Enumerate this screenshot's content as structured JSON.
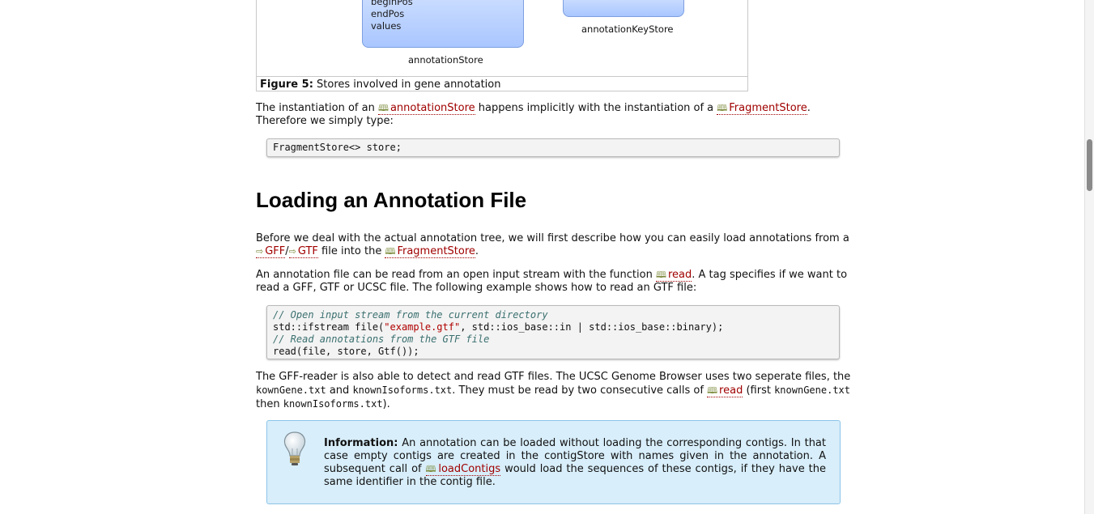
{
  "figure": {
    "store_a_fields": [
      "beginPos",
      "endPos",
      "values"
    ],
    "store_a_label": "annotationStore",
    "store_b_label": "annotationKeyStore",
    "caption_bold": "Figure 5:",
    "caption_text": "Stores involved in gene annotation"
  },
  "para1": {
    "t1": "The instantiation of an ",
    "link1": "annotationStore",
    "t2": " happens implicitly with the instantiation of a ",
    "link2": "FragmentStore",
    "t3": ". Therefore we simply type:"
  },
  "code1": "FragmentStore<> store;",
  "heading": "Loading an Annotation File",
  "para2": {
    "t1": "Before we deal with the actual annotation tree, we will first describe how you can easily load annotations from a ",
    "link1": "GFF",
    "sep": "/",
    "link2": "GTF",
    "t2": " file into the ",
    "link3": "FragmentStore",
    "t3": "."
  },
  "para3": {
    "t1": "An annotation file can be read from an open input stream with the function ",
    "link1": "read",
    "t2": ". A tag specifies if we want to read a GFF, GTF or UCSC file. The following example shows how to read an GTF file:"
  },
  "code2": {
    "l1_comment": "// Open input stream from the current directory",
    "l2a": "std::ifstream file(",
    "l2str": "\"example.gtf\"",
    "l2b": ", std::ios_base::in | std::ios_base::binary);",
    "l3_comment": "// Read annotations from the GTF file",
    "l4": "read(file, store, Gtf());"
  },
  "para4": {
    "t1": "The GFF-reader is also able to detect and read GTF files. The UCSC Genome Browser uses two seperate files, the ",
    "c1": "kownGene.txt",
    "t2": " and ",
    "c2": "knownIsoforms.txt",
    "t3": ". They must be read by two consecutive calls of ",
    "link1": "read",
    "t4": " (first ",
    "c3": "knownGene.txt",
    "t5": " then ",
    "c4": "knownIsoforms.txt",
    "t6": ")."
  },
  "info": {
    "label": "Information:",
    "t1": " An annotation can be loaded without loading the corresponding contigs. In that case empty contigs are created in the contigStore with names given in the annotation. A subsequent call of ",
    "link1": "loadContigs",
    "t2": " would load the sequences of these contigs, if they have the same identifier in the contig file."
  },
  "icons": {
    "book": "book-icon",
    "arrow": "arrow-link-icon",
    "bulb": "lightbulb-icon"
  }
}
